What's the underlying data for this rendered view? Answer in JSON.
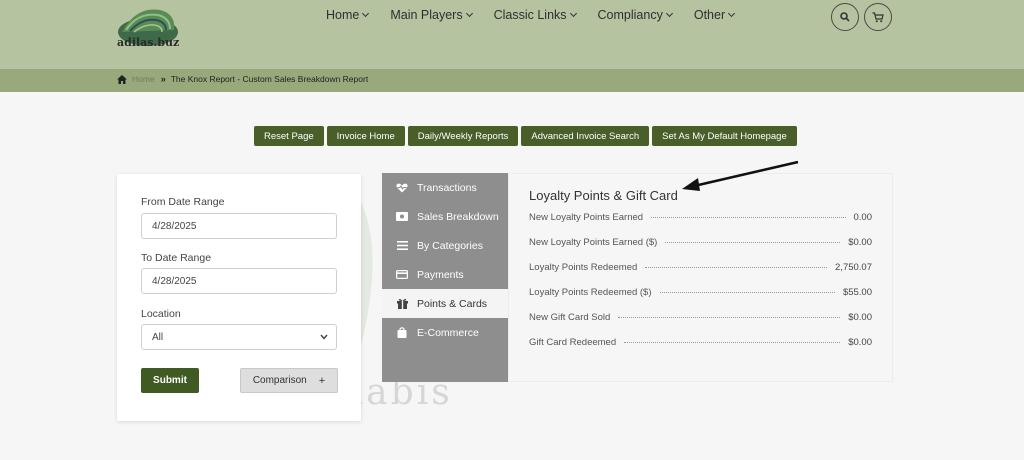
{
  "brand": {
    "name": "adilas.buz"
  },
  "nav": {
    "items": [
      {
        "label": "Home"
      },
      {
        "label": "Main Players"
      },
      {
        "label": "Classic Links"
      },
      {
        "label": "Compliancy"
      },
      {
        "label": "Other"
      }
    ]
  },
  "breadcrumb": {
    "home": "Home",
    "current": "The Knox Report - Custom Sales Breakdown Report"
  },
  "actions": [
    {
      "label": "Reset Page"
    },
    {
      "label": "Invoice Home"
    },
    {
      "label": "Daily/Weekly Reports"
    },
    {
      "label": "Advanced Invoice Search"
    },
    {
      "label": "Set As My Default Homepage"
    }
  ],
  "form": {
    "from_label": "From Date Range",
    "from_value": "4/28/2025",
    "to_label": "To Date Range",
    "to_value": "4/28/2025",
    "location_label": "Location",
    "location_value": "All",
    "submit_label": "Submit",
    "comparison_label": "Comparison",
    "comparison_icon": "+"
  },
  "tabs": [
    {
      "label": "Transactions",
      "icon": "heart-pulse-icon"
    },
    {
      "label": "Sales Breakdown",
      "icon": "money-icon"
    },
    {
      "label": "By Categories",
      "icon": "list-icon"
    },
    {
      "label": "Payments",
      "icon": "credit-card-icon"
    },
    {
      "label": "Points & Cards",
      "icon": "gift-icon",
      "active": true
    },
    {
      "label": "E-Commerce",
      "icon": "shopping-bag-icon"
    }
  ],
  "panel": {
    "title": "Loyalty Points & Gift Card",
    "rows": [
      {
        "label": "New Loyalty Points Earned",
        "value": "0.00"
      },
      {
        "label": "New Loyalty Points Earned ($)",
        "value": "$0.00"
      },
      {
        "label": "Loyalty Points Redeemed",
        "value": "2,750.07"
      },
      {
        "label": "Loyalty Points Redeemed ($)",
        "value": "$55.00"
      },
      {
        "label": "New Gift Card Sold",
        "value": "$0.00"
      },
      {
        "label": "Gift Card Redeemed",
        "value": "$0.00"
      }
    ]
  },
  "watermark": {
    "text": "nabis"
  },
  "colors": {
    "header": "#b6c3a0",
    "breadcrumb_bar": "#98a97c",
    "accent": "#4a5e2a",
    "tab_bg": "#8e8e8e"
  }
}
